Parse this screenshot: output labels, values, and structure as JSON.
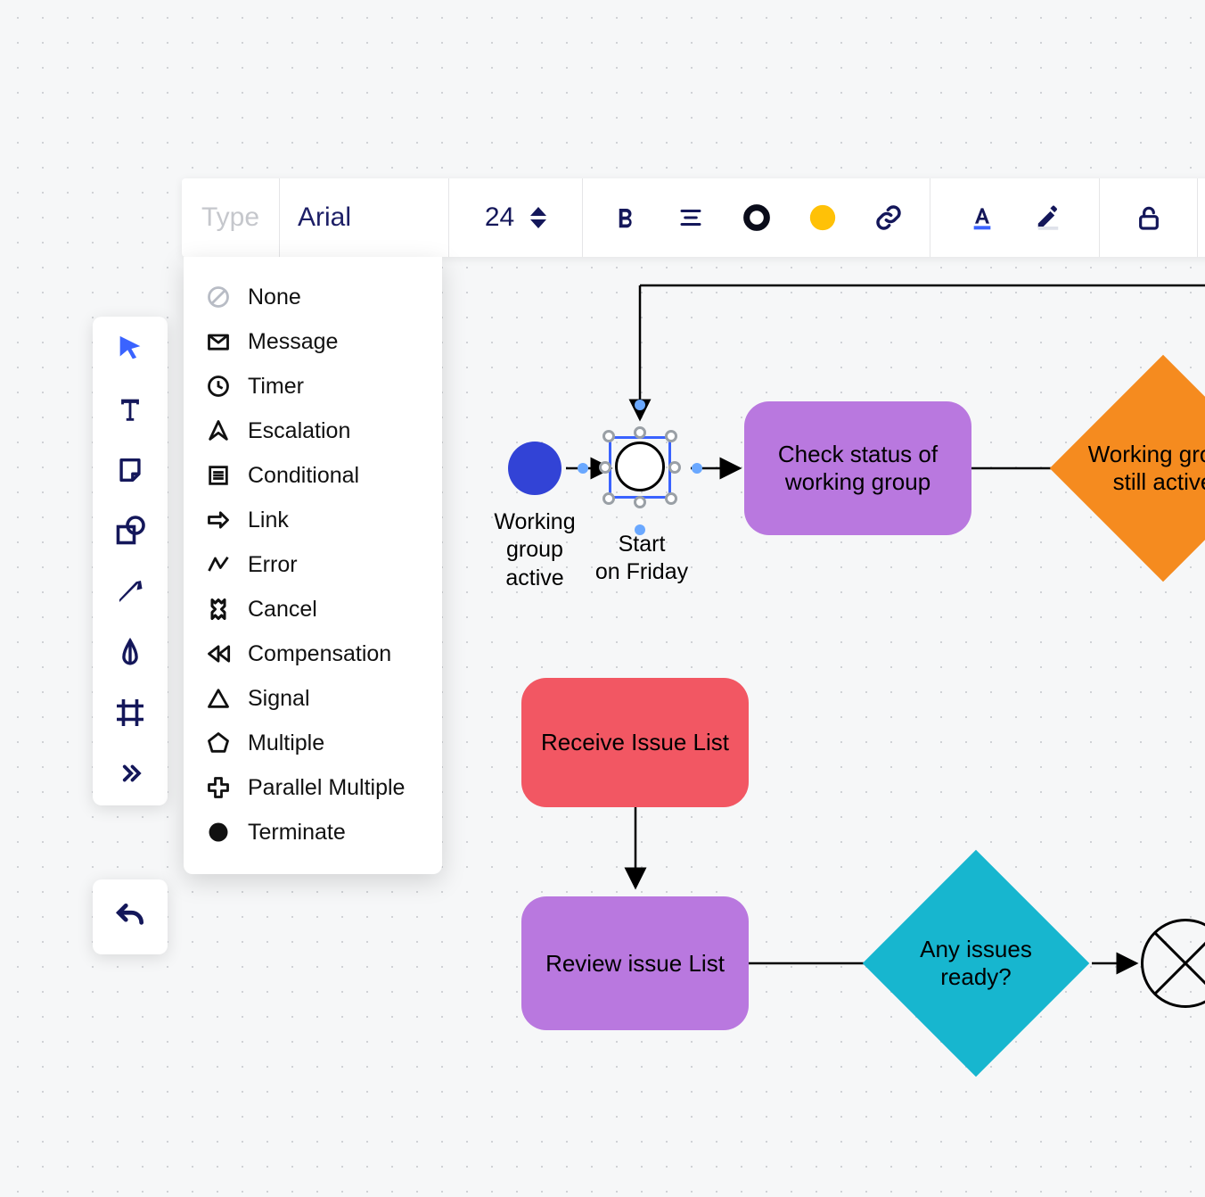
{
  "topbar": {
    "type_label": "Type",
    "font_name": "Arial",
    "font_size": "24",
    "more": "•••"
  },
  "dropdown": {
    "items": [
      {
        "icon": "none-icon",
        "label": "None"
      },
      {
        "icon": "message-icon",
        "label": "Message"
      },
      {
        "icon": "timer-icon",
        "label": "Timer"
      },
      {
        "icon": "escalation-icon",
        "label": "Escalation"
      },
      {
        "icon": "conditional-icon",
        "label": "Conditional"
      },
      {
        "icon": "link-icon",
        "label": "Link"
      },
      {
        "icon": "error-icon",
        "label": "Error"
      },
      {
        "icon": "cancel-icon",
        "label": "Cancel"
      },
      {
        "icon": "compensation-icon",
        "label": "Compensation"
      },
      {
        "icon": "signal-icon",
        "label": "Signal"
      },
      {
        "icon": "multiple-icon",
        "label": "Multiple"
      },
      {
        "icon": "parallel-icon",
        "label": "Parallel Multiple"
      },
      {
        "icon": "terminate-icon",
        "label": "Terminate"
      }
    ]
  },
  "nodes": {
    "start_label": "Working\ngroup\nactive",
    "selected_label": "Start\non Friday",
    "check_status": "Check status of working group",
    "working_group_active": "Working group still active",
    "receive": "Receive Issue List",
    "review": "Review issue List",
    "any_issues": "Any issues ready?"
  },
  "colors": {
    "purple": "#b978df",
    "red": "#f25763",
    "orange": "#f58b1f",
    "teal": "#17b6cf",
    "start": "#3243d6",
    "accent_yellow": "#ffc107"
  }
}
